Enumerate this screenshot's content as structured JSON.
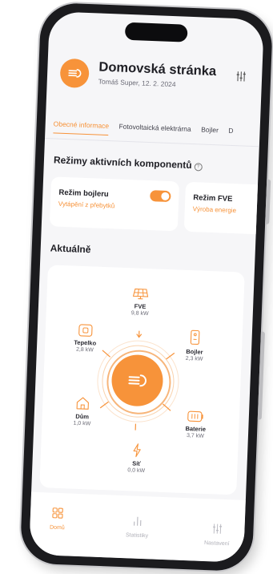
{
  "header": {
    "title": "Domovská stránka",
    "subtitle": "Tomáš Super, 12. 2. 2024"
  },
  "tabs": [
    {
      "label": "Obecné informace",
      "active": true
    },
    {
      "label": "Fotovoltaická elektrárna",
      "active": false
    },
    {
      "label": "Bojler",
      "active": false
    },
    {
      "label": "D",
      "active": false
    }
  ],
  "modes": {
    "title": "Režimy aktivních komponentů",
    "info_icon": "info-icon",
    "cards": [
      {
        "title": "Režim bojleru",
        "subtitle": "Vytápění z přebytků",
        "toggle_on": true
      },
      {
        "title": "Režim FVE",
        "subtitle": "Výroba energie"
      }
    ]
  },
  "current": {
    "title": "Aktuálně",
    "center_icon": "home-energy-logo-icon",
    "nodes": [
      {
        "id": "fve",
        "name": "FVE",
        "value": "9,8 kW",
        "icon": "solar-panel-icon"
      },
      {
        "id": "bojler",
        "name": "Bojler",
        "value": "2,3 kW",
        "icon": "boiler-icon"
      },
      {
        "id": "baterie",
        "name": "Baterie",
        "value": "3,7 kW",
        "icon": "battery-icon"
      },
      {
        "id": "sit",
        "name": "Síť",
        "value": "0,0 kW",
        "icon": "lightning-icon"
      },
      {
        "id": "dum",
        "name": "Dům",
        "value": "1,0 kW",
        "icon": "house-icon"
      },
      {
        "id": "tepelko",
        "name": "Tepelko",
        "value": "2,8 kW",
        "icon": "heat-pump-icon"
      }
    ]
  },
  "nav": {
    "items": [
      {
        "label": "Domů",
        "icon": "grid-icon",
        "active": true
      },
      {
        "label": "Statistiky",
        "icon": "bar-chart-icon",
        "active": false
      },
      {
        "label": "Nastavení",
        "icon": "sliders-icon",
        "active": false
      }
    ]
  },
  "colors": {
    "accent": "#f7933a",
    "text": "#1f1f25",
    "muted": "#6d6d78",
    "background": "#f6f6f8"
  }
}
